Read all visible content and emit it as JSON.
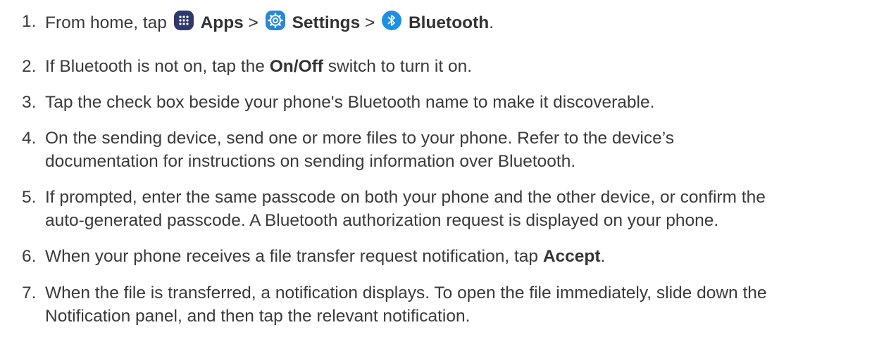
{
  "steps": [
    {
      "number": "1.",
      "parts": {
        "a": "From home, tap",
        "apps": "Apps",
        "sep1": ">",
        "settings": "Settings",
        "sep2": ">",
        "bluetooth": "Bluetooth",
        "end": "."
      },
      "icons": [
        "apps-grid-icon",
        "settings-gear-icon",
        "bluetooth-icon"
      ],
      "icon_colors": {
        "apps": "#2e3a6b",
        "settings": "#2a86d9",
        "bluetooth": "#1f8fe5"
      }
    },
    {
      "number": "2.",
      "parts": {
        "a": "If Bluetooth is not on, tap the",
        "bold": "On/Off",
        "b": "switch to turn it on."
      }
    },
    {
      "number": "3.",
      "line1": "Tap the check box beside your phone's Bluetooth name to make it discoverable."
    },
    {
      "number": "4.",
      "line1": "On the sending device, send one or more files to your phone. Refer to the device’s",
      "line2": "documentation for instructions on sending information over Bluetooth."
    },
    {
      "number": "5.",
      "line1": "If prompted, enter the same passcode on both your phone and the other device, or confirm the",
      "line2": "auto-generated passcode. A Bluetooth authorization request is displayed on your phone."
    },
    {
      "number": "6.",
      "parts": {
        "a": "When your phone receives a file transfer request notification, tap",
        "bold": "Accept",
        "end": "."
      }
    },
    {
      "number": "7.",
      "line1": "When the file is transferred, a notification displays. To open the file immediately, slide down the",
      "line2": "Notification panel, and then tap the relevant notification."
    }
  ]
}
